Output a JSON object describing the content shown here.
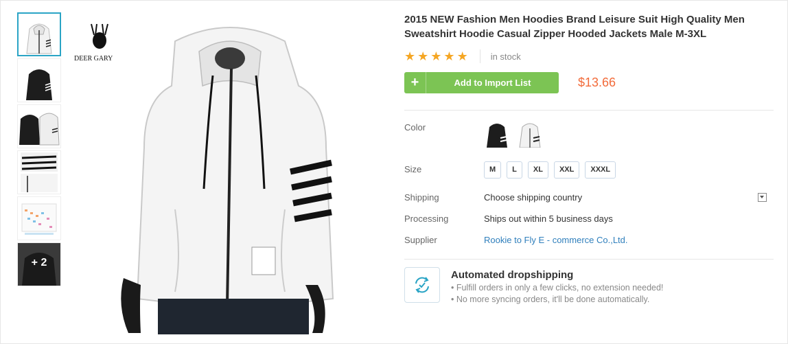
{
  "product": {
    "title": "2015 NEW Fashion Men Hoodies Brand Leisure Suit High Quality Men Sweatshirt Hoodie Casual Zipper Hooded Jackets Male M-3XL",
    "rating_stars": 5,
    "stock": "in stock",
    "price": "$13.66",
    "brand_logo": "DEER GARY"
  },
  "actions": {
    "add_plus": "+",
    "add_label": "Add to Import List"
  },
  "thumbnails": {
    "more_label": "+ 2"
  },
  "attributes": {
    "color": {
      "label": "Color"
    },
    "size": {
      "label": "Size",
      "options": [
        "M",
        "L",
        "XL",
        "XXL",
        "XXXL"
      ]
    },
    "shipping": {
      "label": "Shipping",
      "value": "Choose shipping country"
    },
    "processing": {
      "label": "Processing",
      "value": "Ships out within 5 business days"
    },
    "supplier": {
      "label": "Supplier",
      "value": "Rookie to Fly E - commerce Co.,Ltd."
    }
  },
  "dropshipping": {
    "title": "Automated dropshipping",
    "line1": "• Fulfill orders in only a few clicks, no extension needed!",
    "line2": "• No more syncing orders, it'll be done automatically."
  },
  "icons": {
    "star": "star-icon",
    "dropdown": "chevron-down-icon",
    "automation": "sync-icon"
  },
  "colors": {
    "accent_green": "#7cc454",
    "price": "#f26b3a",
    "link": "#2f7fbc",
    "star": "#f5a623",
    "thumb_active": "#2aa4c5"
  }
}
